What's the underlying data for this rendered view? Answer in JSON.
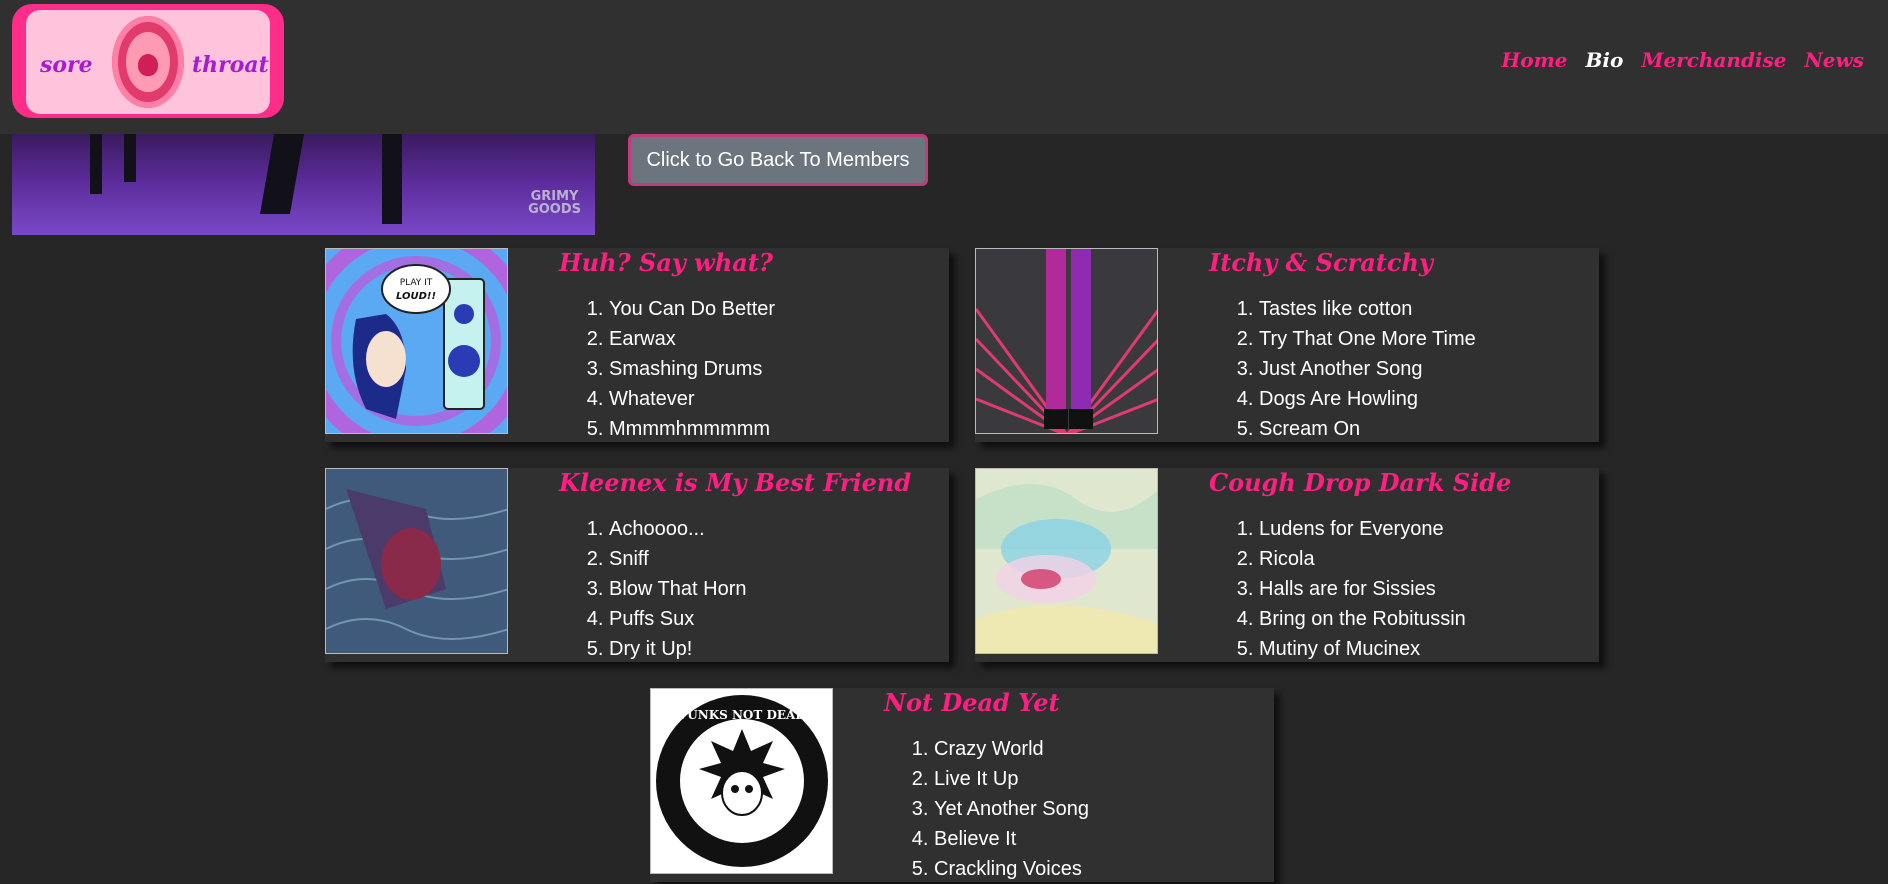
{
  "logo": {
    "left_word": "sore",
    "right_word": "throat"
  },
  "nav": [
    {
      "label": "Home",
      "active": false
    },
    {
      "label": "Bio",
      "active": true
    },
    {
      "label": "Merchandise",
      "active": false
    },
    {
      "label": "News",
      "active": false
    }
  ],
  "hero": {
    "watermark_line1": "GRIMY",
    "watermark_line2": "GOODS"
  },
  "back_button": {
    "label": "Click to Go Back To Members"
  },
  "albums": [
    {
      "title": "Huh? Say what?",
      "cover_text_1": "PLAY IT",
      "cover_text_2": "LOUD!!",
      "tracks": [
        "You Can Do Better",
        "Earwax",
        "Smashing Drums",
        "Whatever",
        "Mmmmhmmmmm"
      ]
    },
    {
      "title": "Itchy & Scratchy",
      "tracks": [
        "Tastes like cotton",
        "Try That One More Time",
        "Just Another Song",
        "Dogs Are Howling",
        "Scream On"
      ]
    },
    {
      "title": "Kleenex is My Best Friend",
      "tracks": [
        "Achoooo...",
        "Sniff",
        "Blow That Horn",
        "Puffs Sux",
        "Dry it Up!"
      ]
    },
    {
      "title": "Cough Drop Dark Side",
      "tracks": [
        "Ludens for Everyone",
        "Ricola",
        "Halls are for Sissies",
        "Bring on the Robitussin",
        "Mutiny of Mucinex"
      ]
    },
    {
      "title": "Not Dead Yet",
      "cover_text_1": "PUNKS NOT DEAD",
      "tracks": [
        "Crazy World",
        "Live It Up",
        "Yet Another Song",
        "Believe It",
        "Crackling Voices"
      ]
    }
  ]
}
